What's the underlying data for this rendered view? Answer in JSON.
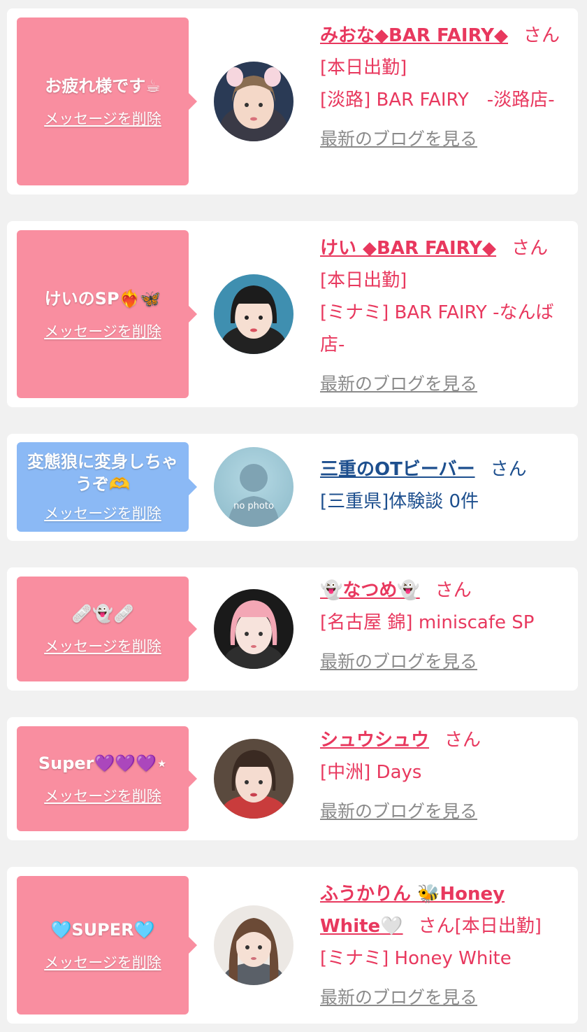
{
  "colors": {
    "pink": "#f98ea0",
    "blue": "#8bb9f5",
    "name_red": "#e8385e",
    "name_navy": "#1d4f8e",
    "link_gray": "#8a8a8a",
    "background": "#f1f1f1"
  },
  "common": {
    "delete_label": "メッセージを削除",
    "blog_label": "最新のブログを見る",
    "san": "さん"
  },
  "cards": [
    {
      "message": "お疲れ様です☕",
      "name": "みおな◆BAR FAIRY◆",
      "status": "[本日出勤]",
      "shop": "[淡路] BAR FAIRY　-淡路店-",
      "avatar": "cat-ears-girl"
    },
    {
      "message": "けいのSP❤️‍🔥🦋",
      "name": "けい ◆BAR FAIRY◆",
      "status": "[本日出勤]",
      "shop": "[ミナミ] BAR FAIRY -なんば店-",
      "avatar": "bob-hair-girl"
    },
    {
      "message": "変態狼に変身しちゃうぞ🫶",
      "name": "三重のOTビーバー",
      "status": "",
      "shop": "[三重県]体験談 0件",
      "avatar": "no-photo",
      "avatar_text": "no photo"
    },
    {
      "message": "🩹👻🩹",
      "name": "👻なつめ👻",
      "status": "",
      "shop": "[名古屋 錦] miniscafe SP",
      "avatar": "pink-hair-girl"
    },
    {
      "message": "Super💜💜💜⋆",
      "name": "シュウシュウ",
      "status": "",
      "shop": "[中洲] Days",
      "avatar": "bangs-girl"
    },
    {
      "message": "🩵SUPER🩵",
      "name": "ふうかりん 🐝Honey White🤍",
      "status": "[本日出勤]",
      "shop": "[ミナミ] Honey White",
      "avatar": "long-hair-girl"
    }
  ]
}
